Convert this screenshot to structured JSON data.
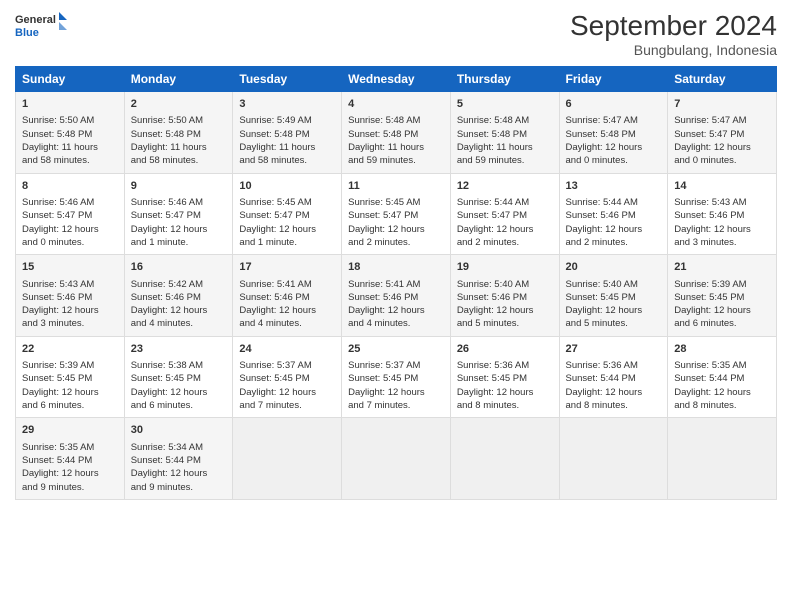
{
  "header": {
    "logo_line1": "General",
    "logo_line2": "Blue",
    "month": "September 2024",
    "location": "Bungbulang, Indonesia"
  },
  "weekdays": [
    "Sunday",
    "Monday",
    "Tuesday",
    "Wednesday",
    "Thursday",
    "Friday",
    "Saturday"
  ],
  "weeks": [
    [
      {
        "day": "1",
        "lines": [
          "Sunrise: 5:50 AM",
          "Sunset: 5:48 PM",
          "Daylight: 11 hours",
          "and 58 minutes."
        ]
      },
      {
        "day": "2",
        "lines": [
          "Sunrise: 5:50 AM",
          "Sunset: 5:48 PM",
          "Daylight: 11 hours",
          "and 58 minutes."
        ]
      },
      {
        "day": "3",
        "lines": [
          "Sunrise: 5:49 AM",
          "Sunset: 5:48 PM",
          "Daylight: 11 hours",
          "and 58 minutes."
        ]
      },
      {
        "day": "4",
        "lines": [
          "Sunrise: 5:48 AM",
          "Sunset: 5:48 PM",
          "Daylight: 11 hours",
          "and 59 minutes."
        ]
      },
      {
        "day": "5",
        "lines": [
          "Sunrise: 5:48 AM",
          "Sunset: 5:48 PM",
          "Daylight: 11 hours",
          "and 59 minutes."
        ]
      },
      {
        "day": "6",
        "lines": [
          "Sunrise: 5:47 AM",
          "Sunset: 5:48 PM",
          "Daylight: 12 hours",
          "and 0 minutes."
        ]
      },
      {
        "day": "7",
        "lines": [
          "Sunrise: 5:47 AM",
          "Sunset: 5:47 PM",
          "Daylight: 12 hours",
          "and 0 minutes."
        ]
      }
    ],
    [
      {
        "day": "8",
        "lines": [
          "Sunrise: 5:46 AM",
          "Sunset: 5:47 PM",
          "Daylight: 12 hours",
          "and 0 minutes."
        ]
      },
      {
        "day": "9",
        "lines": [
          "Sunrise: 5:46 AM",
          "Sunset: 5:47 PM",
          "Daylight: 12 hours",
          "and 1 minute."
        ]
      },
      {
        "day": "10",
        "lines": [
          "Sunrise: 5:45 AM",
          "Sunset: 5:47 PM",
          "Daylight: 12 hours",
          "and 1 minute."
        ]
      },
      {
        "day": "11",
        "lines": [
          "Sunrise: 5:45 AM",
          "Sunset: 5:47 PM",
          "Daylight: 12 hours",
          "and 2 minutes."
        ]
      },
      {
        "day": "12",
        "lines": [
          "Sunrise: 5:44 AM",
          "Sunset: 5:47 PM",
          "Daylight: 12 hours",
          "and 2 minutes."
        ]
      },
      {
        "day": "13",
        "lines": [
          "Sunrise: 5:44 AM",
          "Sunset: 5:46 PM",
          "Daylight: 12 hours",
          "and 2 minutes."
        ]
      },
      {
        "day": "14",
        "lines": [
          "Sunrise: 5:43 AM",
          "Sunset: 5:46 PM",
          "Daylight: 12 hours",
          "and 3 minutes."
        ]
      }
    ],
    [
      {
        "day": "15",
        "lines": [
          "Sunrise: 5:43 AM",
          "Sunset: 5:46 PM",
          "Daylight: 12 hours",
          "and 3 minutes."
        ]
      },
      {
        "day": "16",
        "lines": [
          "Sunrise: 5:42 AM",
          "Sunset: 5:46 PM",
          "Daylight: 12 hours",
          "and 4 minutes."
        ]
      },
      {
        "day": "17",
        "lines": [
          "Sunrise: 5:41 AM",
          "Sunset: 5:46 PM",
          "Daylight: 12 hours",
          "and 4 minutes."
        ]
      },
      {
        "day": "18",
        "lines": [
          "Sunrise: 5:41 AM",
          "Sunset: 5:46 PM",
          "Daylight: 12 hours",
          "and 4 minutes."
        ]
      },
      {
        "day": "19",
        "lines": [
          "Sunrise: 5:40 AM",
          "Sunset: 5:46 PM",
          "Daylight: 12 hours",
          "and 5 minutes."
        ]
      },
      {
        "day": "20",
        "lines": [
          "Sunrise: 5:40 AM",
          "Sunset: 5:45 PM",
          "Daylight: 12 hours",
          "and 5 minutes."
        ]
      },
      {
        "day": "21",
        "lines": [
          "Sunrise: 5:39 AM",
          "Sunset: 5:45 PM",
          "Daylight: 12 hours",
          "and 6 minutes."
        ]
      }
    ],
    [
      {
        "day": "22",
        "lines": [
          "Sunrise: 5:39 AM",
          "Sunset: 5:45 PM",
          "Daylight: 12 hours",
          "and 6 minutes."
        ]
      },
      {
        "day": "23",
        "lines": [
          "Sunrise: 5:38 AM",
          "Sunset: 5:45 PM",
          "Daylight: 12 hours",
          "and 6 minutes."
        ]
      },
      {
        "day": "24",
        "lines": [
          "Sunrise: 5:37 AM",
          "Sunset: 5:45 PM",
          "Daylight: 12 hours",
          "and 7 minutes."
        ]
      },
      {
        "day": "25",
        "lines": [
          "Sunrise: 5:37 AM",
          "Sunset: 5:45 PM",
          "Daylight: 12 hours",
          "and 7 minutes."
        ]
      },
      {
        "day": "26",
        "lines": [
          "Sunrise: 5:36 AM",
          "Sunset: 5:45 PM",
          "Daylight: 12 hours",
          "and 8 minutes."
        ]
      },
      {
        "day": "27",
        "lines": [
          "Sunrise: 5:36 AM",
          "Sunset: 5:44 PM",
          "Daylight: 12 hours",
          "and 8 minutes."
        ]
      },
      {
        "day": "28",
        "lines": [
          "Sunrise: 5:35 AM",
          "Sunset: 5:44 PM",
          "Daylight: 12 hours",
          "and 8 minutes."
        ]
      }
    ],
    [
      {
        "day": "29",
        "lines": [
          "Sunrise: 5:35 AM",
          "Sunset: 5:44 PM",
          "Daylight: 12 hours",
          "and 9 minutes."
        ]
      },
      {
        "day": "30",
        "lines": [
          "Sunrise: 5:34 AM",
          "Sunset: 5:44 PM",
          "Daylight: 12 hours",
          "and 9 minutes."
        ]
      },
      {
        "day": "",
        "lines": []
      },
      {
        "day": "",
        "lines": []
      },
      {
        "day": "",
        "lines": []
      },
      {
        "day": "",
        "lines": []
      },
      {
        "day": "",
        "lines": []
      }
    ]
  ]
}
